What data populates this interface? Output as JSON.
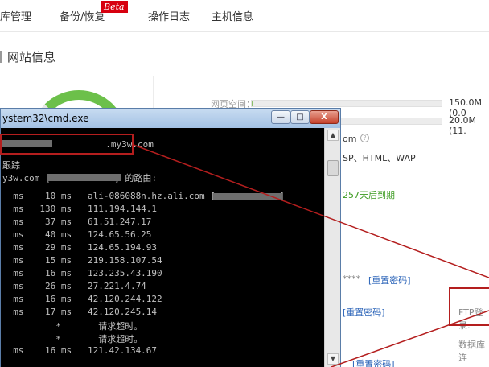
{
  "nav": {
    "items": [
      "库管理",
      "备份/恢复",
      "操作日志",
      "主机信息"
    ],
    "beta": "Beta"
  },
  "page_title": "网站信息",
  "usage": {
    "space_label": "网页空间：",
    "space_value": "150.0M (0.0",
    "db_value": "20.0M (11.",
    "db_fill": 0.04
  },
  "info": {
    "domain_suffix": "om",
    "langs": "SP、HTML、WAP",
    "expire": "257天后到期",
    "reset1": "[重置密码]",
    "reset2": "[重置密码]",
    "reset3": "[重置密码]",
    "mask": "****",
    "ftp_label": "FTP登录:",
    "db_conn": "数据库连"
  },
  "cmd": {
    "title": "ystem32\\cmd.exe",
    "min": "—",
    "max": "□",
    "close": "X",
    "lines": [
      "          .my3w.com",
      "跟踪",
      "y3w.com [            ] 的路由:",
      "",
      "  ms    10 ms   ali-086088n.hz.ali.com [            ]",
      "  ms   130 ms   111.194.144.1",
      "  ms    37 ms   61.51.247.17",
      "  ms    40 ms   124.65.56.25",
      "  ms    29 ms   124.65.194.93",
      "  ms    15 ms   219.158.107.54",
      "  ms    16 ms   123.235.43.190",
      "  ms    26 ms   27.221.4.74",
      "  ms    16 ms   42.120.244.122",
      "  ms    17 ms   42.120.245.14",
      "          *       请求超时。",
      "          *       请求超时。",
      "  ms    16 ms   121.42.134.67"
    ]
  }
}
